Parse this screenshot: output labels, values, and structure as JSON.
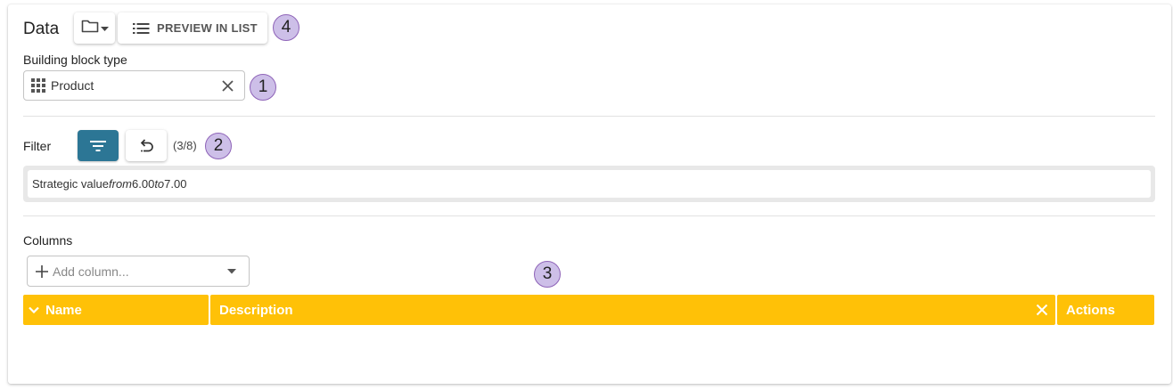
{
  "header": {
    "title": "Data",
    "preview_label": "PREVIEW IN LIST",
    "badge": "4"
  },
  "building_block": {
    "label": "Building block type",
    "value": "Product",
    "badge": "1"
  },
  "filter": {
    "label": "Filter",
    "count": "(3/8)",
    "badge": "2",
    "criteria": {
      "field": "Strategic value",
      "from_word": "from",
      "from_value": "6.00",
      "to_word": "to",
      "to_value": "7.00"
    }
  },
  "columns": {
    "label": "Columns",
    "add_placeholder": "Add column...",
    "badge": "3",
    "headers": [
      "Name",
      "Description",
      "Actions"
    ]
  },
  "colors": {
    "accent": "#2c7695",
    "column_header": "#ffc107",
    "badge_fill": "#cdbfe8",
    "badge_border": "#8e63b8"
  }
}
